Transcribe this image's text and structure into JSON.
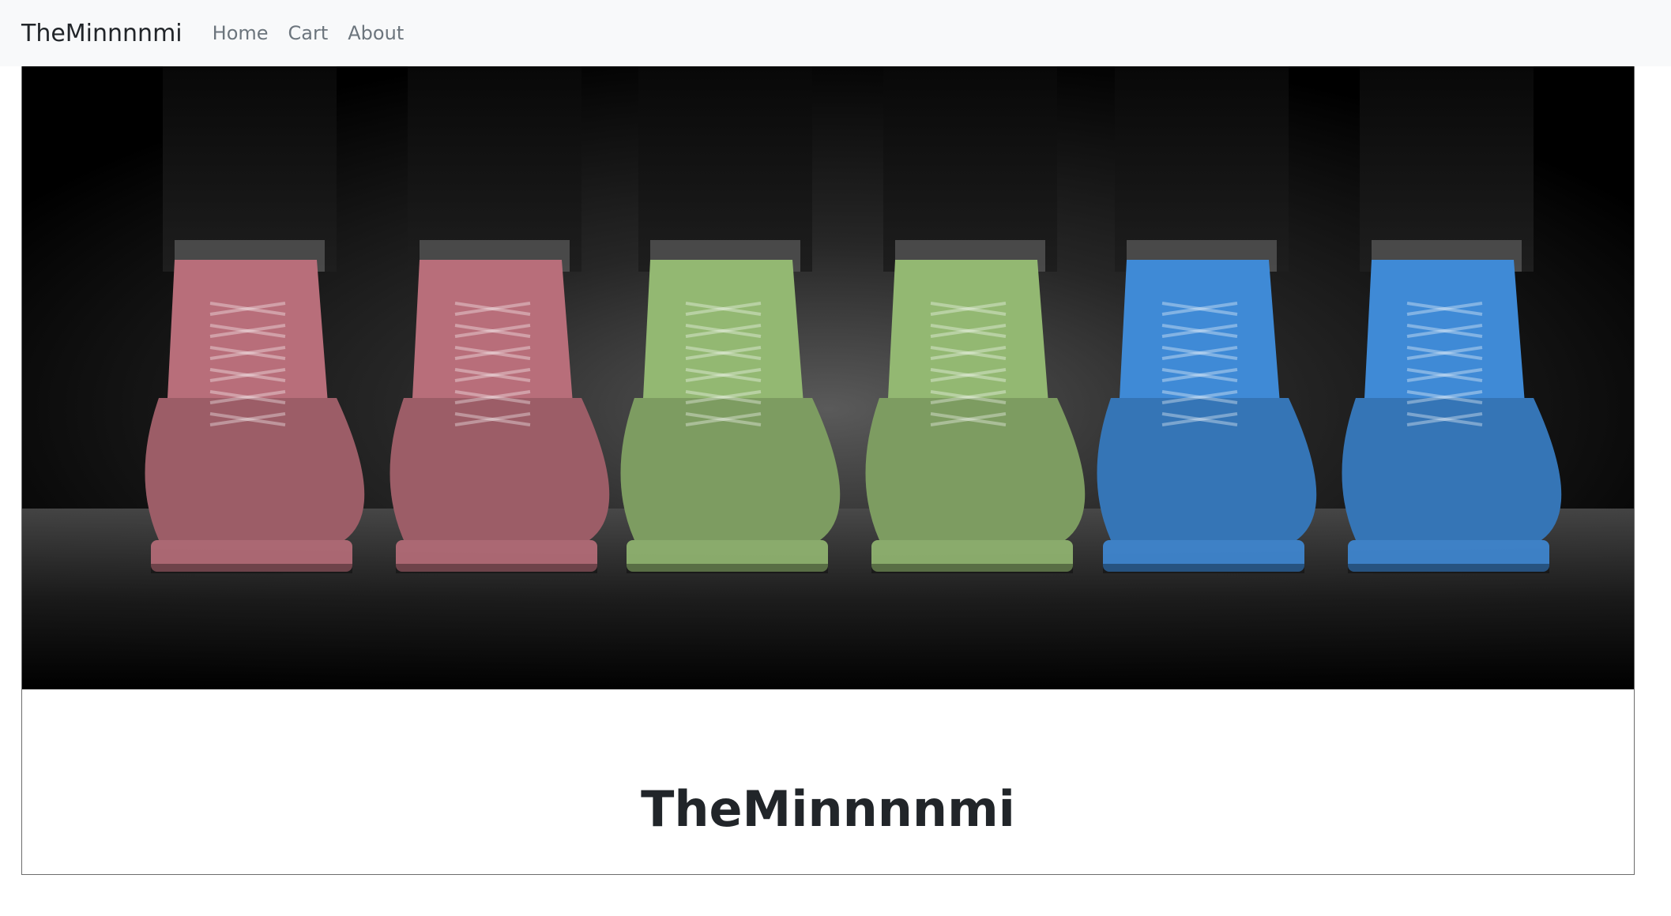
{
  "navbar": {
    "brand": "TheMinnnnmi",
    "links": [
      {
        "label": "Home"
      },
      {
        "label": "Cart"
      },
      {
        "label": "About"
      }
    ],
    "background": "#f8f9fa"
  },
  "hero": {
    "image_subject": "three pairs of boots in pink, green and blue on a dark stage",
    "boot_colors": [
      "#b86e7a",
      "#93b872",
      "#3f8ad6"
    ]
  },
  "card": {
    "title": "TheMinnnnmi"
  }
}
